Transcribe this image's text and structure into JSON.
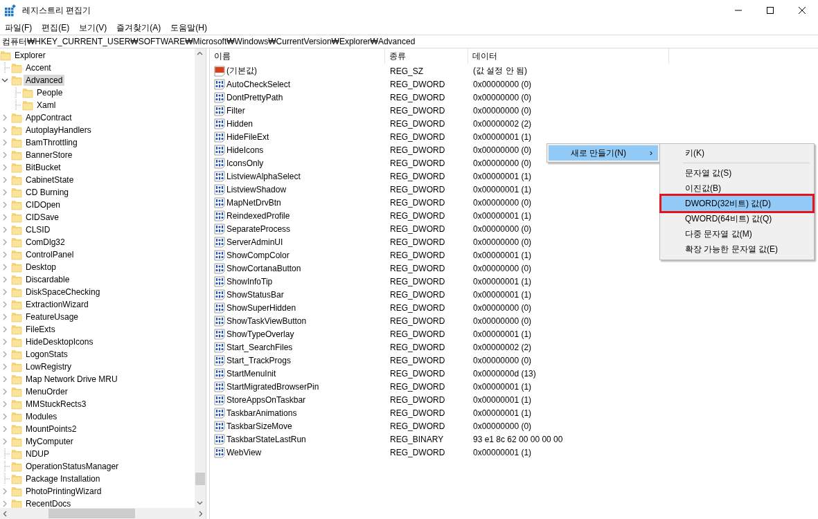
{
  "window": {
    "title": "레지스트리 편집기"
  },
  "menu": [
    "파일(F)",
    "편집(E)",
    "보기(V)",
    "즐겨찾기(A)",
    "도움말(H)"
  ],
  "address": "컴퓨터₩HKEY_CURRENT_USER₩SOFTWARE₩Microsoft₩Windows₩CurrentVersion₩Explorer₩Advanced",
  "tree": {
    "label": "Explorer",
    "kind": "expanded",
    "selected": false,
    "children": [
      {
        "label": "Accent",
        "kind": "leaf",
        "selected": false
      },
      {
        "label": "Advanced",
        "kind": "expanded",
        "selected": true,
        "children": [
          {
            "label": "People",
            "kind": "leaf",
            "selected": false
          },
          {
            "label": "Xaml",
            "kind": "leaf",
            "selected": false
          }
        ]
      },
      {
        "label": "AppContract",
        "kind": "collapsed",
        "selected": false
      },
      {
        "label": "AutoplayHandlers",
        "kind": "collapsed",
        "selected": false
      },
      {
        "label": "BamThrottling",
        "kind": "collapsed",
        "selected": false
      },
      {
        "label": "BannerStore",
        "kind": "collapsed",
        "selected": false
      },
      {
        "label": "BitBucket",
        "kind": "collapsed",
        "selected": false
      },
      {
        "label": "CabinetState",
        "kind": "collapsed",
        "selected": false
      },
      {
        "label": "CD Burning",
        "kind": "collapsed",
        "selected": false
      },
      {
        "label": "CIDOpen",
        "kind": "collapsed",
        "selected": false
      },
      {
        "label": "CIDSave",
        "kind": "collapsed",
        "selected": false
      },
      {
        "label": "CLSID",
        "kind": "collapsed",
        "selected": false
      },
      {
        "label": "ComDlg32",
        "kind": "collapsed",
        "selected": false
      },
      {
        "label": "ControlPanel",
        "kind": "collapsed",
        "selected": false
      },
      {
        "label": "Desktop",
        "kind": "collapsed",
        "selected": false
      },
      {
        "label": "Discardable",
        "kind": "collapsed",
        "selected": false
      },
      {
        "label": "DiskSpaceChecking",
        "kind": "collapsed",
        "selected": false
      },
      {
        "label": "ExtractionWizard",
        "kind": "collapsed",
        "selected": false
      },
      {
        "label": "FeatureUsage",
        "kind": "collapsed",
        "selected": false
      },
      {
        "label": "FileExts",
        "kind": "collapsed",
        "selected": false
      },
      {
        "label": "HideDesktopIcons",
        "kind": "collapsed",
        "selected": false
      },
      {
        "label": "LogonStats",
        "kind": "collapsed",
        "selected": false
      },
      {
        "label": "LowRegistry",
        "kind": "collapsed",
        "selected": false
      },
      {
        "label": "Map Network Drive MRU",
        "kind": "collapsed",
        "selected": false
      },
      {
        "label": "MenuOrder",
        "kind": "collapsed",
        "selected": false
      },
      {
        "label": "MMStuckRects3",
        "kind": "collapsed",
        "selected": false
      },
      {
        "label": "Modules",
        "kind": "collapsed",
        "selected": false
      },
      {
        "label": "MountPoints2",
        "kind": "collapsed",
        "selected": false
      },
      {
        "label": "MyComputer",
        "kind": "collapsed",
        "selected": false
      },
      {
        "label": "NDUP",
        "kind": "leaf",
        "selected": false
      },
      {
        "label": "OperationStatusManager",
        "kind": "leaf",
        "selected": false
      },
      {
        "label": "Package Installation",
        "kind": "leaf",
        "selected": false
      },
      {
        "label": "PhotoPrintingWizard",
        "kind": "collapsed",
        "selected": false
      },
      {
        "label": "RecentDocs",
        "kind": "collapsed",
        "selected": false
      }
    ]
  },
  "table": {
    "columns": [
      "이름",
      "종류",
      "데이터"
    ],
    "rows": [
      {
        "kind": "string",
        "name": "(기본값)",
        "type": "REG_SZ",
        "data": "(값 설정 안 됨)"
      },
      {
        "kind": "binary",
        "name": "AutoCheckSelect",
        "type": "REG_DWORD",
        "data": "0x00000000 (0)"
      },
      {
        "kind": "binary",
        "name": "DontPrettyPath",
        "type": "REG_DWORD",
        "data": "0x00000000 (0)"
      },
      {
        "kind": "binary",
        "name": "Filter",
        "type": "REG_DWORD",
        "data": "0x00000000 (0)"
      },
      {
        "kind": "binary",
        "name": "Hidden",
        "type": "REG_DWORD",
        "data": "0x00000002 (2)"
      },
      {
        "kind": "binary",
        "name": "HideFileExt",
        "type": "REG_DWORD",
        "data": "0x00000001 (1)"
      },
      {
        "kind": "binary",
        "name": "HideIcons",
        "type": "REG_DWORD",
        "data": "0x00000000 (0)"
      },
      {
        "kind": "binary",
        "name": "IconsOnly",
        "type": "REG_DWORD",
        "data": "0x00000000 (0)"
      },
      {
        "kind": "binary",
        "name": "ListviewAlphaSelect",
        "type": "REG_DWORD",
        "data": "0x00000001 (1)"
      },
      {
        "kind": "binary",
        "name": "ListviewShadow",
        "type": "REG_DWORD",
        "data": "0x00000001 (1)"
      },
      {
        "kind": "binary",
        "name": "MapNetDrvBtn",
        "type": "REG_DWORD",
        "data": "0x00000000 (0)"
      },
      {
        "kind": "binary",
        "name": "ReindexedProfile",
        "type": "REG_DWORD",
        "data": "0x00000001 (1)"
      },
      {
        "kind": "binary",
        "name": "SeparateProcess",
        "type": "REG_DWORD",
        "data": "0x00000000 (0)"
      },
      {
        "kind": "binary",
        "name": "ServerAdminUI",
        "type": "REG_DWORD",
        "data": "0x00000000 (0)"
      },
      {
        "kind": "binary",
        "name": "ShowCompColor",
        "type": "REG_DWORD",
        "data": "0x00000001 (1)"
      },
      {
        "kind": "binary",
        "name": "ShowCortanaButton",
        "type": "REG_DWORD",
        "data": "0x00000000 (0)"
      },
      {
        "kind": "binary",
        "name": "ShowInfoTip",
        "type": "REG_DWORD",
        "data": "0x00000001 (1)"
      },
      {
        "kind": "binary",
        "name": "ShowStatusBar",
        "type": "REG_DWORD",
        "data": "0x00000001 (1)"
      },
      {
        "kind": "binary",
        "name": "ShowSuperHidden",
        "type": "REG_DWORD",
        "data": "0x00000000 (0)"
      },
      {
        "kind": "binary",
        "name": "ShowTaskViewButton",
        "type": "REG_DWORD",
        "data": "0x00000000 (0)"
      },
      {
        "kind": "binary",
        "name": "ShowTypeOverlay",
        "type": "REG_DWORD",
        "data": "0x00000001 (1)"
      },
      {
        "kind": "binary",
        "name": "Start_SearchFiles",
        "type": "REG_DWORD",
        "data": "0x00000002 (2)"
      },
      {
        "kind": "binary",
        "name": "Start_TrackProgs",
        "type": "REG_DWORD",
        "data": "0x00000000 (0)"
      },
      {
        "kind": "binary",
        "name": "StartMenuInit",
        "type": "REG_DWORD",
        "data": "0x0000000d (13)"
      },
      {
        "kind": "binary",
        "name": "StartMigratedBrowserPin",
        "type": "REG_DWORD",
        "data": "0x00000001 (1)"
      },
      {
        "kind": "binary",
        "name": "StoreAppsOnTaskbar",
        "type": "REG_DWORD",
        "data": "0x00000001 (1)"
      },
      {
        "kind": "binary",
        "name": "TaskbarAnimations",
        "type": "REG_DWORD",
        "data": "0x00000001 (1)"
      },
      {
        "kind": "binary",
        "name": "TaskbarSizeMove",
        "type": "REG_DWORD",
        "data": "0x00000000 (0)"
      },
      {
        "kind": "binary",
        "name": "TaskbarStateLastRun",
        "type": "REG_BINARY",
        "data": "93 e1 8c 62 00 00 00 00"
      },
      {
        "kind": "binary",
        "name": "WebView",
        "type": "REG_DWORD",
        "data": "0x00000001 (1)"
      }
    ]
  },
  "context_menu": {
    "items": [
      {
        "label": "새로 만들기(N)",
        "arrow": "›",
        "selected": true
      }
    ]
  },
  "submenu": {
    "items": [
      {
        "kind": "item",
        "label": "키(K)",
        "selected": false,
        "outlined": false
      },
      {
        "kind": "separator"
      },
      {
        "kind": "item",
        "label": "문자열 값(S)",
        "selected": false,
        "outlined": false
      },
      {
        "kind": "item",
        "label": "이진값(B)",
        "selected": false,
        "outlined": false
      },
      {
        "kind": "item",
        "label": "DWORD(32비트) 값(D)",
        "selected": true,
        "outlined": true
      },
      {
        "kind": "item",
        "label": "QWORD(64비트) 값(Q)",
        "selected": false,
        "outlined": false
      },
      {
        "kind": "item",
        "label": "다중 문자열 값(M)",
        "selected": false,
        "outlined": false
      },
      {
        "kind": "item",
        "label": "확장 가능한 문자열 값(E)",
        "selected": false,
        "outlined": false
      }
    ]
  }
}
